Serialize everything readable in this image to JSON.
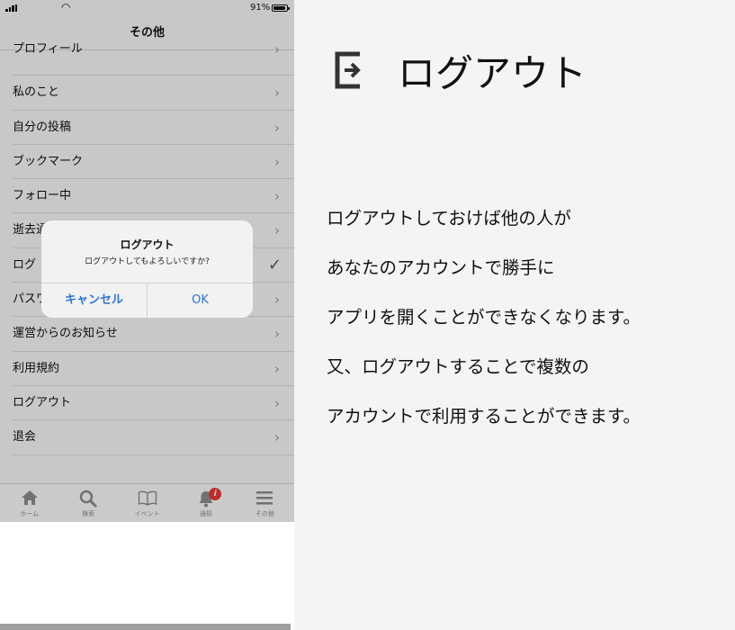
{
  "status": {
    "battery_pct": "91%"
  },
  "nav": {
    "title": "その他"
  },
  "menu": [
    {
      "label": "プロフィール"
    },
    {
      "label": "私のこと"
    },
    {
      "label": "自分の投稿"
    },
    {
      "label": "ブックマーク"
    },
    {
      "label": "フォロー中"
    },
    {
      "label": "逝去通"
    },
    {
      "label": "ログ"
    },
    {
      "label": "パスワ"
    },
    {
      "label": "運営からのお知らせ"
    },
    {
      "label": "利用規約"
    },
    {
      "label": "ログアウト"
    },
    {
      "label": "退会"
    }
  ],
  "alert": {
    "title": "ログアウト",
    "message": "ログアウトしてもよろしいですか?",
    "cancel_label": "キャンセル",
    "ok_label": "OK"
  },
  "tabs": [
    {
      "label": "ホーム",
      "icon": "home-icon"
    },
    {
      "label": "検索",
      "icon": "search-icon"
    },
    {
      "label": "イベント",
      "icon": "book-icon"
    },
    {
      "label": "通知",
      "icon": "bell-icon",
      "badge": "i"
    },
    {
      "label": "その他",
      "icon": "menu-icon"
    }
  ],
  "info": {
    "heading": "ログアウト",
    "lines": [
      "ログアウトしておけば他の人が",
      "あなたのアカウントで勝手に",
      "アプリを開くことができなくなります。",
      "又、ログアウトすることで複数の",
      "アカウントで利用することができます。"
    ]
  },
  "colors": {
    "accent": "#2f74d0",
    "badge": "#e53935"
  }
}
